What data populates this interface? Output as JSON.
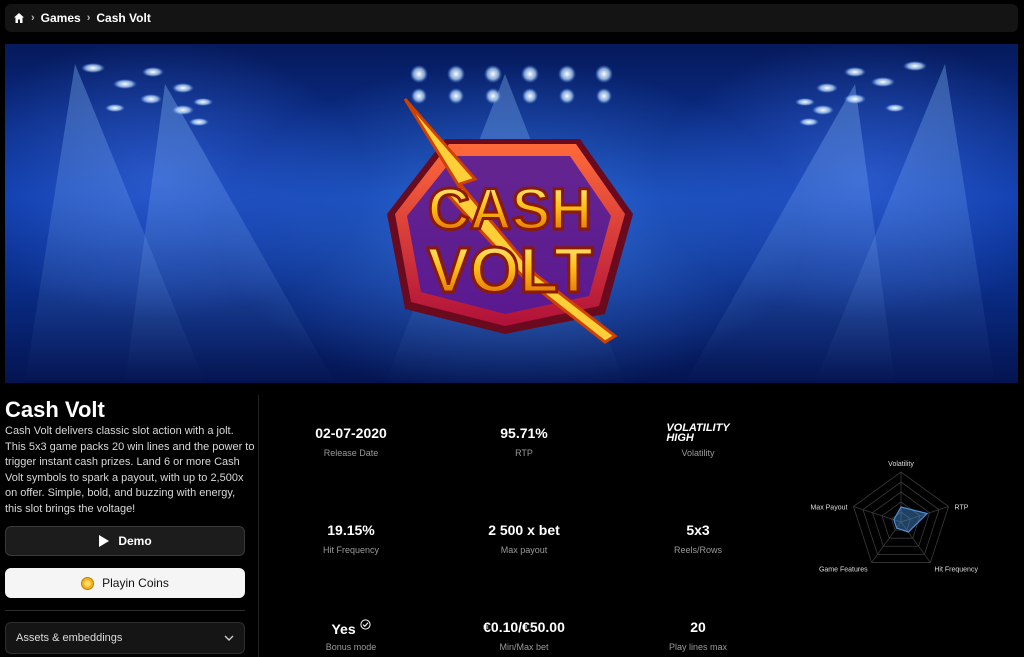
{
  "breadcrumb": {
    "items": [
      "Games",
      "Cash Volt"
    ]
  },
  "hero": {
    "logo_line1": "CASH",
    "logo_line2": "VOLT"
  },
  "game": {
    "title": "Cash Volt",
    "description": "Cash Volt delivers classic slot action with a jolt. This 5x3 game packs 20 win lines and the power to trigger instant cash prizes. Land 6 or more Cash Volt symbols to spark a payout, with up to 2,500x on offer. Simple, bold, and buzzing with energy, this slot brings the voltage!"
  },
  "actions": {
    "demo_label": "Demo",
    "coins_label": "Playin Coins",
    "assets_label": "Assets & embeddings"
  },
  "stats": {
    "release_date": {
      "value": "02-07-2020",
      "label": "Release Date"
    },
    "rtp": {
      "value": "95.71%",
      "label": "RTP"
    },
    "volatility": {
      "value_line1": "VOLATILITY",
      "value_line2": "HIGH",
      "label": "Volatility"
    },
    "hit_frequency": {
      "value": "19.15%",
      "label": "Hit Frequency"
    },
    "max_payout": {
      "value": "2 500 x bet",
      "label": "Max payout"
    },
    "reels_rows": {
      "value": "5x3",
      "label": "Reels/Rows"
    },
    "bonus_mode": {
      "value": "Yes",
      "label": "Bonus mode"
    },
    "min_max_bet": {
      "value": "€0.10/€50.00",
      "label": "Min/Max bet"
    },
    "play_lines": {
      "value": "20",
      "label": "Play lines max"
    }
  },
  "radar": {
    "axes": [
      "Volatility",
      "RTP",
      "Hit Frequency",
      "Game Features",
      "Max Payout"
    ],
    "values": [
      0.3,
      0.55,
      0.25,
      0.15,
      0.15
    ],
    "accent": "#4a90d9"
  },
  "colors": {
    "background": "#000000",
    "panel": "#141414",
    "accent": "#4a90d9"
  }
}
